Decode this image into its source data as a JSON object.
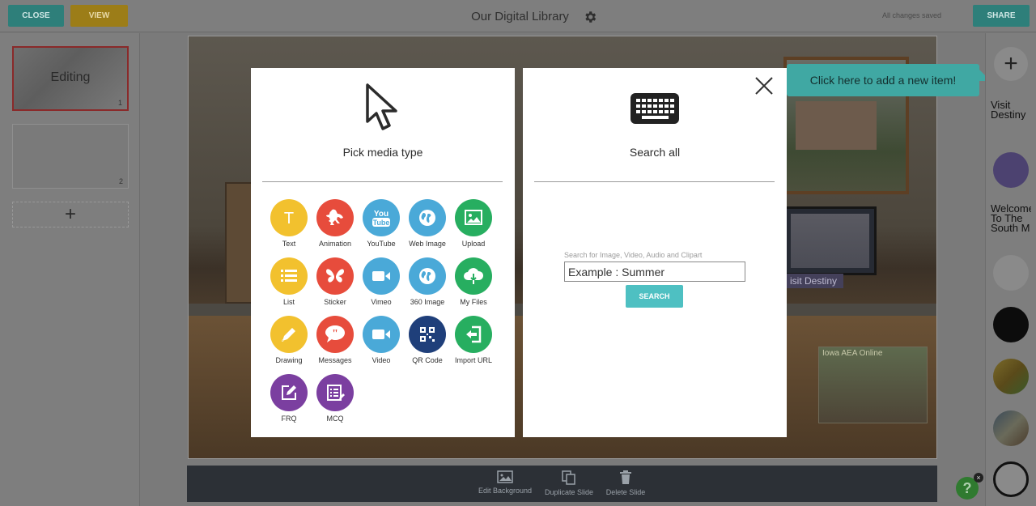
{
  "header": {
    "close_label": "CLOSE",
    "view_label": "VIEW",
    "title": "Our Digital Library",
    "save_status": "All changes saved",
    "share_label": "SHARE"
  },
  "slides": {
    "items": [
      {
        "label": "Editing",
        "number": "1"
      },
      {
        "label": "",
        "number": "2"
      }
    ],
    "add_label": "+"
  },
  "canvas": {
    "sign_text": "isit Destiny",
    "poster_title": "Iowa AEA Online"
  },
  "media_panel": {
    "title": "Pick media type",
    "items": [
      {
        "label": "Text",
        "icon": "text-icon",
        "color": "#f2c12e"
      },
      {
        "label": "Animation",
        "icon": "rabbit-icon",
        "color": "#e74c3c"
      },
      {
        "label": "YouTube",
        "icon": "youtube-icon",
        "color": "#4aa9d8"
      },
      {
        "label": "Web Image",
        "icon": "globe-icon",
        "color": "#4aa9d8"
      },
      {
        "label": "Upload",
        "icon": "image-icon",
        "color": "#27ae60"
      },
      {
        "label": "List",
        "icon": "list-icon",
        "color": "#f2c12e"
      },
      {
        "label": "Sticker",
        "icon": "butterfly-icon",
        "color": "#e74c3c"
      },
      {
        "label": "Vimeo",
        "icon": "video-camera-icon",
        "color": "#4aa9d8"
      },
      {
        "label": "360 Image",
        "icon": "globe-icon",
        "color": "#4aa9d8"
      },
      {
        "label": "My Files",
        "icon": "cloud-download-icon",
        "color": "#27ae60"
      },
      {
        "label": "Drawing",
        "icon": "pencil-icon",
        "color": "#f2c12e"
      },
      {
        "label": "Messages",
        "icon": "quote-icon",
        "color": "#e74c3c"
      },
      {
        "label": "Video",
        "icon": "video-camera-icon",
        "color": "#4aa9d8"
      },
      {
        "label": "QR Code",
        "icon": "qr-code-icon",
        "color": "#1f3f7a"
      },
      {
        "label": "Import URL",
        "icon": "import-icon",
        "color": "#27ae60"
      },
      {
        "label": "FRQ",
        "icon": "edit-icon",
        "color": "#7b3fa0"
      },
      {
        "label": "MCQ",
        "icon": "checklist-icon",
        "color": "#7b3fa0"
      }
    ]
  },
  "search_panel": {
    "title": "Search all",
    "search_hint": "Search for Image, Video, Audio and Clipart",
    "placeholder": "Example : Summer",
    "button_label": "SEARCH"
  },
  "tooltip": {
    "text": "Click here to add a new item!"
  },
  "rail": {
    "add_label": "+",
    "text_item_1": "Visit Destiny",
    "text_item_2": "Welcome To The South M"
  },
  "toolbar": {
    "edit_background": "Edit Background",
    "duplicate_slide": "Duplicate Slide",
    "delete_slide": "Delete Slide"
  },
  "help": {
    "label": "?",
    "dismiss": "×"
  }
}
